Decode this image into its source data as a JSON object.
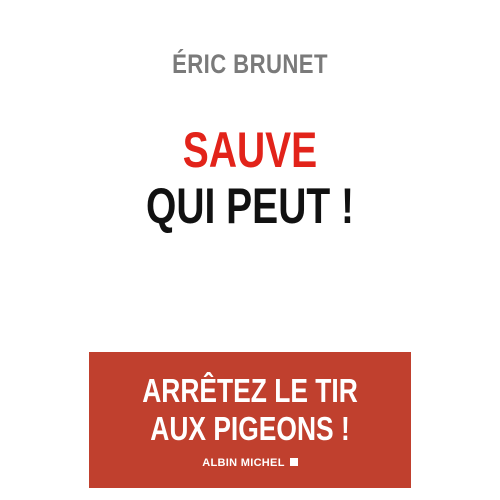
{
  "cover": {
    "author": "ÉRIC BRUNET",
    "title_line_1": "SAUVE",
    "title_line_2": "QUI PEUT !",
    "subtitle_line_1": "ARRÊTEZ LE TIR",
    "subtitle_line_2": "AUX PIGEONS !",
    "publisher": "ALBIN MICHEL"
  },
  "colors": {
    "title_accent": "#e2231a",
    "title_dark": "#111111",
    "author_gray": "#7a7a7a",
    "band_background": "#c0402e",
    "band_text": "#ffffff"
  }
}
